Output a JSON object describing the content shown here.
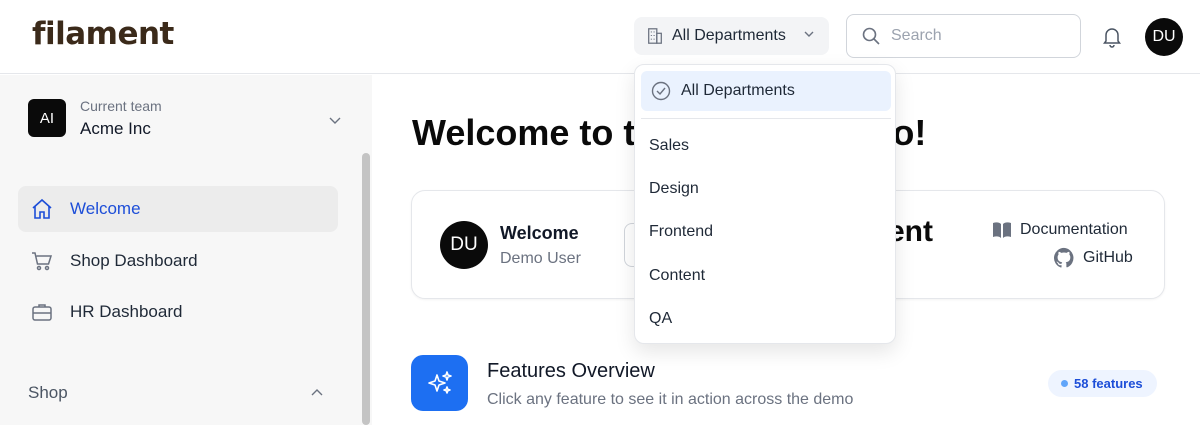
{
  "header": {
    "logo": "filament",
    "department_selector": "All Departments",
    "search_placeholder": "Search",
    "user_initials": "DU"
  },
  "sidebar": {
    "team": {
      "initials": "AI",
      "label": "Current team",
      "name": "Acme Inc"
    },
    "items": [
      {
        "label": "Welcome",
        "icon": "home-icon",
        "active": true
      },
      {
        "label": "Shop Dashboard",
        "icon": "cart-icon",
        "active": false
      },
      {
        "label": "HR Dashboard",
        "icon": "briefcase-icon",
        "active": false
      }
    ],
    "section": "Shop"
  },
  "main": {
    "title": "Welcome to th",
    "title_end": "o!",
    "card": {
      "initials": "DU",
      "title": "Welcome",
      "subtitle": "Demo User",
      "big_text": "ent",
      "links": {
        "documentation": "Documentation",
        "github": "GitHub"
      }
    },
    "features": {
      "title": "Features Overview",
      "subtitle": "Click any feature to see it in action across the demo",
      "badge": "58 features"
    }
  },
  "dropdown": {
    "selected": "All Departments",
    "options": [
      "Sales",
      "Design",
      "Frontend",
      "Content",
      "QA"
    ]
  },
  "colors": {
    "accent": "#1d4ed8",
    "feature_icon_bg": "#1d6ff2",
    "logo": "#3b2a1a",
    "dropdown_selected_bg": "#eaf2fe"
  }
}
